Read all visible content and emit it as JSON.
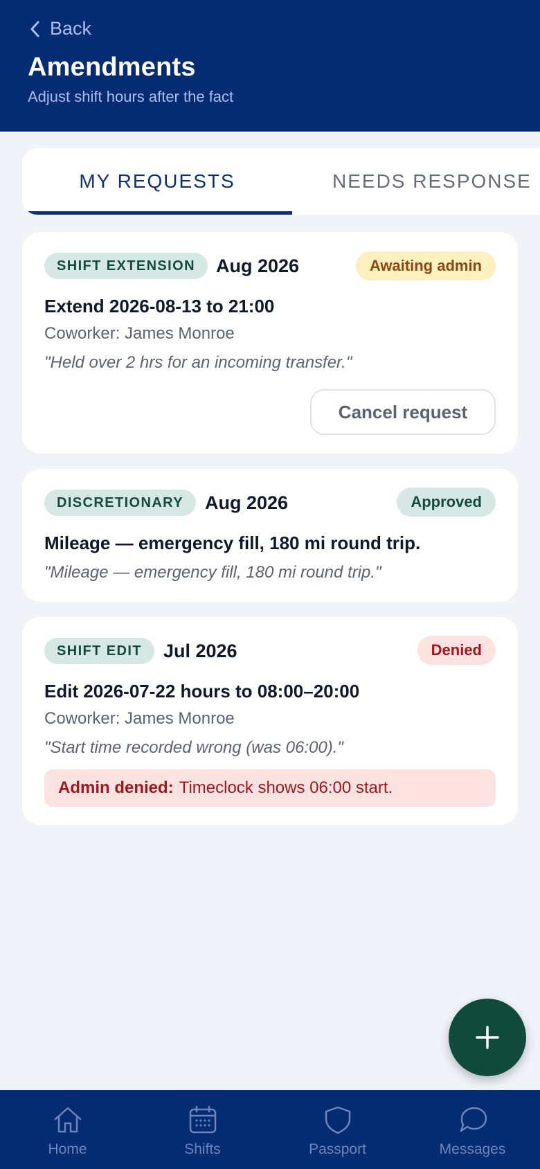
{
  "header": {
    "back_label": "Back",
    "title": "Amendments",
    "subtitle": "Adjust shift hours after the fact"
  },
  "tabs": [
    {
      "label": "MY REQUESTS",
      "active": true
    },
    {
      "label": "NEEDS RESPONSE",
      "active": false
    }
  ],
  "requests": [
    {
      "type": "SHIFT EXTENSION",
      "month": "Aug 2026",
      "status": "Awaiting admin",
      "title": "Extend 2026-08-13 to 21:00",
      "coworker": "Coworker: James Monroe",
      "note": "\"Held over 2 hrs for an incoming transfer.\"",
      "action_label": "Cancel request"
    },
    {
      "type": "DISCRETIONARY",
      "month": "Aug 2026",
      "status": "Approved",
      "title": "Mileage — emergency fill, 180 mi round trip.",
      "note": "\"Mileage — emergency fill, 180 mi round trip.\""
    },
    {
      "type": "SHIFT EDIT",
      "month": "Jul 2026",
      "status": "Denied",
      "title": "Edit 2026-07-22 hours to 08:00–20:00",
      "coworker": "Coworker: James Monroe",
      "note": "\"Start time recorded wrong (was 06:00).\"",
      "denial_label": "Admin denied:",
      "denial_reason": "Timeclock shows 06:00 start."
    }
  ],
  "fab": {
    "icon": "plus-icon"
  },
  "bottom_nav": [
    {
      "label": "Home",
      "icon": "home-icon"
    },
    {
      "label": "Shifts",
      "icon": "calendar-icon"
    },
    {
      "label": "Passport",
      "icon": "shield-icon"
    },
    {
      "label": "Messages",
      "icon": "chat-bubble-icon"
    }
  ],
  "colors": {
    "header_bg": "#032c72",
    "accent": "#0b2f78",
    "fab_bg": "#0f4a3b",
    "approved": "#144a3b",
    "awaiting": "#8d4a10",
    "denied": "#a3161b"
  }
}
